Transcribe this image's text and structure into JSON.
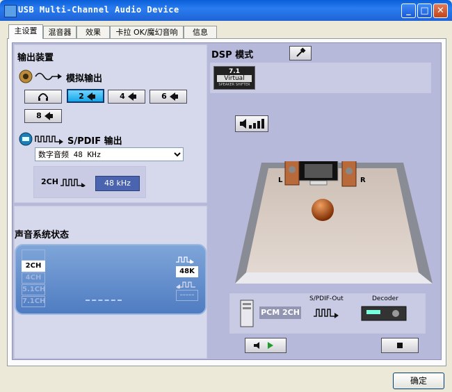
{
  "window": {
    "title": "USB Multi-Channel Audio Device"
  },
  "titlebar_buttons": {
    "minimize": "_",
    "maximize": "□",
    "close": "✕"
  },
  "tabs": [
    {
      "label": "主设置",
      "active": true
    },
    {
      "label": "混音器",
      "active": false
    },
    {
      "label": "效果",
      "active": false
    },
    {
      "label": "卡拉 OK/魔幻音响",
      "active": false
    },
    {
      "label": "信息",
      "active": false
    }
  ],
  "output": {
    "heading": "输出装置",
    "analog_label": "模拟输出",
    "channel_buttons": [
      {
        "label": "",
        "icon": "headphones-icon",
        "selected": false
      },
      {
        "label": "2",
        "selected": true
      },
      {
        "label": "4",
        "selected": false
      },
      {
        "label": "6",
        "selected": false
      },
      {
        "label": "8",
        "selected": false
      }
    ],
    "spdif_label": "S/PDIF 输出",
    "spdif_select": {
      "value": "数字音频 48 KHz"
    },
    "spdif_channel": "2CH",
    "spdif_rate": "48 kHz"
  },
  "dsp": {
    "heading": "DSP 模式",
    "virtual_badge": {
      "line1": "7.1",
      "line2": "Virtual",
      "line3": "SPEAKER SHIFTER"
    },
    "left_speaker": "L",
    "right_speaker": "R",
    "pcm_label": "PCM 2CH",
    "spdif_out_label": "S/PDIF-Out",
    "decoder_label": "Decoder"
  },
  "status": {
    "heading": "声音系统状态",
    "channels": [
      {
        "label": "2CH",
        "active": true
      },
      {
        "label": "4CH",
        "active": false
      },
      {
        "label": "5.1CH",
        "active": false
      },
      {
        "label": "7.1CH",
        "active": false
      }
    ],
    "rate": "48K",
    "input_rate": "-----"
  },
  "ok_button": "确定",
  "colors": {
    "titlebar": "#1f63d6",
    "panel": "#b6b9d9",
    "section": "#d6d8ec",
    "selected_channel": "#18a6e8"
  }
}
